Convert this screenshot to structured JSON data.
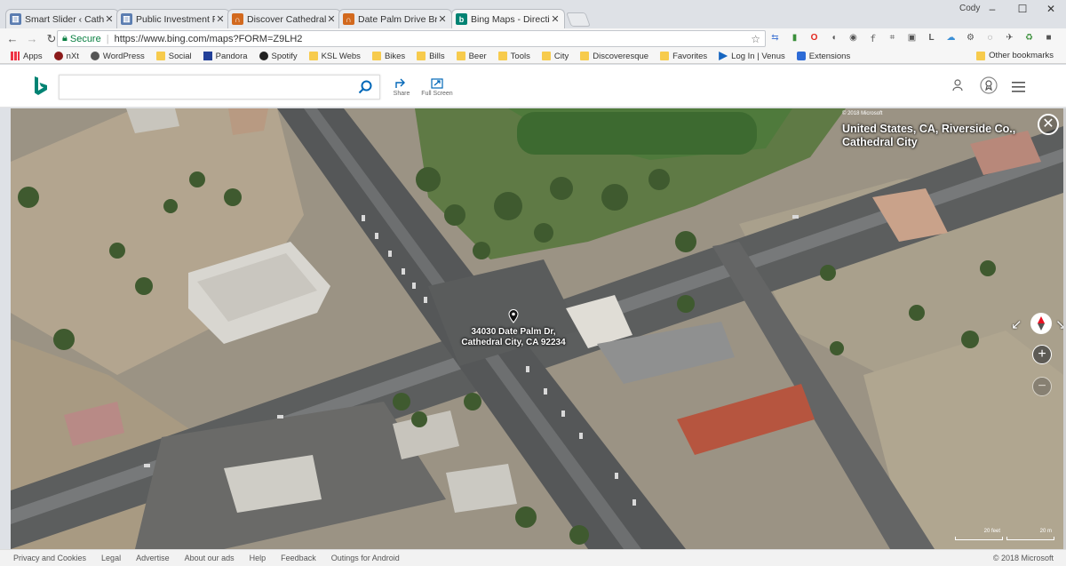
{
  "browser": {
    "tabs": [
      {
        "title": "Smart Slider ‹ Cathedral C",
        "icon": "pillars-icon",
        "color": "#5b7db1",
        "active": false
      },
      {
        "title": "Public Investment Presen",
        "icon": "pillars-icon",
        "color": "#5b7db1",
        "active": false
      },
      {
        "title": "Discover Cathedral City -",
        "icon": "arch-icon",
        "color": "#d2691e",
        "active": false
      },
      {
        "title": "Date Palm Drive Bridge V",
        "icon": "arch-icon",
        "color": "#d2691e",
        "active": false
      },
      {
        "title": "Bing Maps - Directions, t",
        "icon": "bing-icon",
        "color": "#008373",
        "active": true
      }
    ],
    "profile": "Cody",
    "window": {
      "minimize": "–",
      "maximize": "☐",
      "close": "✕"
    },
    "omnibox": {
      "secure_label": "Secure",
      "separator": "|",
      "url": "https://www.bing.com/maps?FORM=Z9LH2"
    },
    "extensions": [
      "translate-icon",
      "puzzle-icon",
      "opera-icon",
      "stop-icon",
      "camera-icon",
      "f-icon",
      "crop-icon",
      "screen-icon",
      "l-icon",
      "cloud-icon",
      "gear-icon",
      "circle-icon",
      "run-icon",
      "recycle-icon",
      "box-icon",
      "menu-icon"
    ],
    "bookmarks": [
      {
        "label": "Apps",
        "icon": "apps-icon"
      },
      {
        "label": "nXt",
        "icon": "nxt-icon"
      },
      {
        "label": "WordPress",
        "icon": "wordpress-icon"
      },
      {
        "label": "Social",
        "icon": "folder-icon"
      },
      {
        "label": "Pandora",
        "icon": "pandora-icon"
      },
      {
        "label": "Spotify",
        "icon": "spotify-icon"
      },
      {
        "label": "KSL Webs",
        "icon": "folder-icon"
      },
      {
        "label": "Bikes",
        "icon": "folder-icon"
      },
      {
        "label": "Bills",
        "icon": "folder-icon"
      },
      {
        "label": "Beer",
        "icon": "folder-icon"
      },
      {
        "label": "Tools",
        "icon": "folder-icon"
      },
      {
        "label": "City",
        "icon": "folder-icon"
      },
      {
        "label": "Discoveresque",
        "icon": "folder-icon"
      },
      {
        "label": "Favorites",
        "icon": "folder-icon"
      },
      {
        "label": "Log In | Venus",
        "icon": "play-icon"
      },
      {
        "label": "Extensions",
        "icon": "puzzle-icon"
      }
    ],
    "other_bookmarks": "Other bookmarks"
  },
  "bing": {
    "search_placeholder": "",
    "share_label": "Share",
    "fullscreen_label": "Full Screen"
  },
  "map": {
    "copyright_top": "© 2018 Microsoft",
    "location_title": "United States, CA, Riverside Co., Cathedral City",
    "pin_line1": "34030 Date Palm Dr,",
    "pin_line2": "Cathedral City, CA 92234",
    "zoom_in": "+",
    "zoom_out": "−",
    "scale_left": "20 feet",
    "scale_right": "20 m"
  },
  "footer": {
    "links": [
      "Privacy and Cookies",
      "Legal",
      "Advertise",
      "About our ads",
      "Help",
      "Feedback",
      "Outings for Android"
    ],
    "copyright": "© 2018 Microsoft"
  }
}
